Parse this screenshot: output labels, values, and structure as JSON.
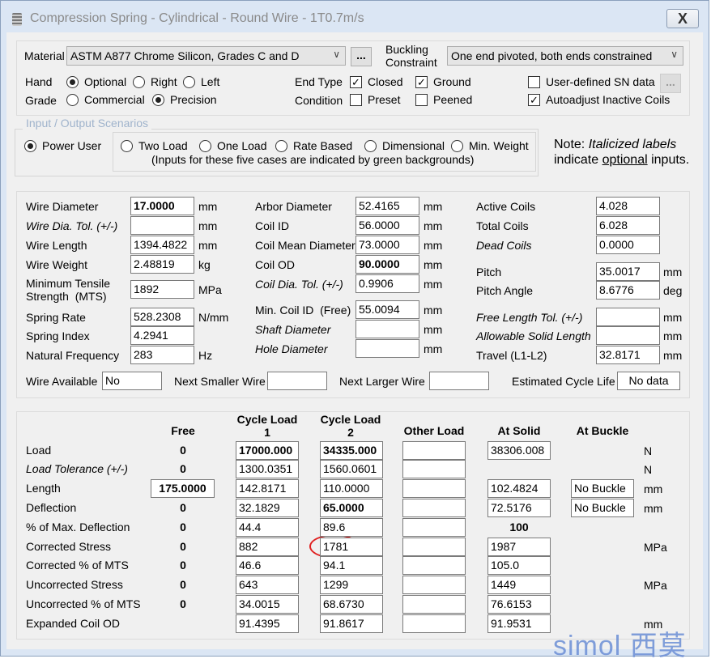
{
  "window": {
    "title": "Compression Spring - Cylindrical - Round Wire - 1T0.7m/s",
    "close_label": "X"
  },
  "top": {
    "material_label": "Material",
    "material_value": "ASTM A877 Chrome Silicon, Grades C and D",
    "browse_label": "...",
    "buckling_label1": "Buckling",
    "buckling_label2": "Constraint",
    "buckling_value": "One end pivoted, both ends constrained",
    "hand_label": "Hand",
    "hand_options": [
      "Optional",
      "Right",
      "Left"
    ],
    "hand_selected": "Optional",
    "grade_label": "Grade",
    "grade_options": [
      "Commercial",
      "Precision"
    ],
    "grade_selected": "Precision",
    "end_type_label": "End Type",
    "closed_label": "Closed",
    "closed": true,
    "ground_label": "Ground",
    "ground": true,
    "condition_label": "Condition",
    "preset_label": "Preset",
    "preset": false,
    "peened_label": "Peened",
    "peened": false,
    "sn_label": "User-defined SN data",
    "sn": false,
    "sn_button": "...",
    "autoadjust_label": "Autoadjust Inactive Coils",
    "autoadjust": true
  },
  "scenarios": {
    "legend": "Input / Output Scenarios",
    "power_user": "Power User",
    "options": [
      "Two Load",
      "One Load",
      "Rate Based",
      "Dimensional",
      "Min. Weight"
    ],
    "selected": "Power User",
    "hint": "(Inputs for these five cases are indicated by green backgrounds)",
    "note_prefix": "Note: ",
    "note_italic": "Italicized labels",
    "note_line2_a": "indicate ",
    "note_line2_u": "optional",
    "note_line2_b": " inputs."
  },
  "dims": {
    "col1": [
      {
        "label": "Wire Diameter",
        "value": "17.0000",
        "unit": "mm",
        "bold": true
      },
      {
        "label": "Wire Dia. Tol. (+/-)",
        "value": "",
        "unit": "mm",
        "italic": true
      },
      {
        "label": "Wire Length",
        "value": "1394.4822",
        "unit": "mm"
      },
      {
        "label": "Wire Weight",
        "value": "2.48819",
        "unit": "kg"
      },
      {
        "label": "Minimum Tensile\nStrength  (MTS)",
        "value": "1892",
        "unit": "MPa"
      },
      {
        "label": "Spring Rate",
        "value": "528.2308",
        "unit": "N/mm"
      },
      {
        "label": "Spring Index",
        "value": "4.2941",
        "unit": ""
      },
      {
        "label": "Natural Frequency",
        "value": "283",
        "unit": "Hz"
      }
    ],
    "col2": [
      {
        "label": "Arbor Diameter",
        "value": "52.4165",
        "unit": "mm"
      },
      {
        "label": "Coil ID",
        "value": "56.0000",
        "unit": "mm"
      },
      {
        "label": "Coil Mean Diameter",
        "value": "73.0000",
        "unit": "mm"
      },
      {
        "label": "Coil OD",
        "value": "90.0000",
        "unit": "mm",
        "bold": true
      },
      {
        "label": "Coil Dia. Tol. (+/-)",
        "value": "0.9906",
        "unit": "mm",
        "italic": true
      },
      {
        "label": "Min. Coil ID  (Free)",
        "value": "55.0094",
        "unit": "mm"
      },
      {
        "label": "Shaft Diameter",
        "value": "",
        "unit": "mm",
        "italic": true
      },
      {
        "label": "Hole Diameter",
        "value": "",
        "unit": "mm",
        "italic": true
      }
    ],
    "col3": [
      {
        "label": "Active Coils",
        "value": "4.028",
        "unit": ""
      },
      {
        "label": "Total Coils",
        "value": "6.028",
        "unit": ""
      },
      {
        "label": "Dead Coils",
        "value": "0.0000",
        "unit": "",
        "italic": true
      },
      {
        "label": "Pitch",
        "value": "35.0017",
        "unit": "mm"
      },
      {
        "label": "Pitch Angle",
        "value": "8.6776",
        "unit": "deg"
      },
      {
        "label": "Free Length Tol. (+/-)",
        "value": "",
        "unit": "mm",
        "italic": true
      },
      {
        "label": "Allowable Solid Length",
        "value": "",
        "unit": "mm",
        "italic": true
      },
      {
        "label": "Travel (L1-L2)",
        "value": "32.8171",
        "unit": "mm"
      }
    ],
    "wire_available_label": "Wire Available",
    "wire_available": "No",
    "next_smaller_label": "Next Smaller Wire",
    "next_smaller": "",
    "next_larger_label": "Next Larger Wire",
    "next_larger": "",
    "cycle_life_label": "Estimated Cycle Life",
    "cycle_life": "No data"
  },
  "loads": {
    "headers": [
      "Free",
      "Cycle Load\n1",
      "Cycle Load\n2",
      "Other Load",
      "At Solid",
      "At Buckle"
    ],
    "rows": [
      {
        "label": "Load",
        "cells": [
          {
            "t": "text",
            "v": "0"
          },
          {
            "t": "input",
            "v": "17000.000",
            "b": true
          },
          {
            "t": "input",
            "v": "34335.000",
            "b": true
          },
          {
            "t": "input",
            "v": ""
          },
          {
            "t": "input",
            "v": "38306.008"
          },
          {
            "t": "none"
          }
        ],
        "unit": "N"
      },
      {
        "label": "Load Tolerance (+/-)",
        "italic": true,
        "cells": [
          {
            "t": "text",
            "v": "0"
          },
          {
            "t": "input",
            "v": "1300.0351"
          },
          {
            "t": "input",
            "v": "1560.0601"
          },
          {
            "t": "input",
            "v": ""
          },
          {
            "t": "none"
          },
          {
            "t": "none"
          }
        ],
        "unit": "N"
      },
      {
        "label": "Length",
        "cells": [
          {
            "t": "input",
            "v": "175.0000",
            "b": true
          },
          {
            "t": "input",
            "v": "142.8171"
          },
          {
            "t": "input",
            "v": "110.0000"
          },
          {
            "t": "input",
            "v": ""
          },
          {
            "t": "input",
            "v": "102.4824"
          },
          {
            "t": "input",
            "v": "No Buckle"
          }
        ],
        "unit": "mm"
      },
      {
        "label": "Deflection",
        "cells": [
          {
            "t": "text",
            "v": "0"
          },
          {
            "t": "input",
            "v": "32.1829"
          },
          {
            "t": "input",
            "v": "65.0000",
            "b": true
          },
          {
            "t": "input",
            "v": ""
          },
          {
            "t": "input",
            "v": "72.5176"
          },
          {
            "t": "input",
            "v": "No Buckle"
          }
        ],
        "unit": "mm"
      },
      {
        "label": "% of Max. Deflection",
        "cells": [
          {
            "t": "text",
            "v": "0"
          },
          {
            "t": "input",
            "v": "44.4"
          },
          {
            "t": "input",
            "v": "89.6"
          },
          {
            "t": "input",
            "v": ""
          },
          {
            "t": "text",
            "v": "100"
          },
          {
            "t": "none"
          }
        ],
        "unit": ""
      },
      {
        "label": "Corrected Stress",
        "cells": [
          {
            "t": "text",
            "v": "0"
          },
          {
            "t": "input",
            "v": "882"
          },
          {
            "t": "input",
            "v": "1781"
          },
          {
            "t": "input",
            "v": ""
          },
          {
            "t": "input",
            "v": "1987"
          },
          {
            "t": "none"
          }
        ],
        "unit": "MPa"
      },
      {
        "label": "Corrected % of MTS",
        "cells": [
          {
            "t": "text",
            "v": "0"
          },
          {
            "t": "input",
            "v": "46.6"
          },
          {
            "t": "input",
            "v": "94.1"
          },
          {
            "t": "input",
            "v": ""
          },
          {
            "t": "input",
            "v": "105.0"
          },
          {
            "t": "none"
          }
        ],
        "unit": ""
      },
      {
        "label": "Uncorrected Stress",
        "cells": [
          {
            "t": "text",
            "v": "0"
          },
          {
            "t": "input",
            "v": "643"
          },
          {
            "t": "input",
            "v": "1299"
          },
          {
            "t": "input",
            "v": ""
          },
          {
            "t": "input",
            "v": "1449"
          },
          {
            "t": "none"
          }
        ],
        "unit": "MPa"
      },
      {
        "label": "Uncorrected % of MTS",
        "cells": [
          {
            "t": "text",
            "v": "0"
          },
          {
            "t": "input",
            "v": "34.0015"
          },
          {
            "t": "input",
            "v": "68.6730"
          },
          {
            "t": "input",
            "v": ""
          },
          {
            "t": "input",
            "v": "76.6153"
          },
          {
            "t": "none"
          }
        ],
        "unit": ""
      },
      {
        "label": "Expanded Coil OD",
        "cells": [
          {
            "t": "none"
          },
          {
            "t": "input",
            "v": "91.4395"
          },
          {
            "t": "input",
            "v": "91.8617"
          },
          {
            "t": "input",
            "v": ""
          },
          {
            "t": "input",
            "v": "91.9531"
          },
          {
            "t": "none"
          }
        ],
        "unit": "mm"
      }
    ]
  },
  "annotation_color": "#e02020",
  "logo": {
    "text": "simol 西莫",
    "color": "#6c8fd6"
  }
}
